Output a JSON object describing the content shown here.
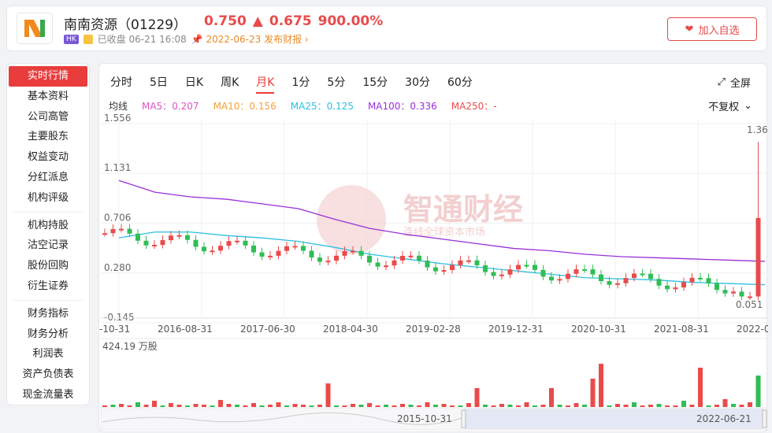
{
  "stock": {
    "name": "南南资源",
    "code": "（01229）",
    "price": "0.750",
    "change": "0.675",
    "change_pct": "900.00%",
    "market_badge": "HK",
    "status": "已收盘 06-21 16:08",
    "report_notice": "2022-06-23 发布财报",
    "up_color": "#e94b4b",
    "down_color": "#2fbe55"
  },
  "header": {
    "favorite_label": "加入自选"
  },
  "sidebar": {
    "groups": [
      [
        "实时行情",
        "基本资料",
        "公司高管",
        "主要股东",
        "权益变动",
        "分红派息",
        "机构评级"
      ],
      [
        "机构持股",
        "沽空记录",
        "股份回购",
        "衍生证券"
      ],
      [
        "财务指标",
        "财务分析",
        "利润表",
        "资产负债表",
        "现金流量表"
      ]
    ]
  },
  "tabs": [
    "分时",
    "5日",
    "日K",
    "周K",
    "月K",
    "1分",
    "5分",
    "15分",
    "30分",
    "60分"
  ],
  "active_tab": "月K",
  "fullscreen_label": "全屏",
  "adjust_label": "不复权",
  "ma_legend": [
    {
      "label": "均线",
      "color": "#333333"
    },
    {
      "label": "MA5：0.207",
      "color": "#e052c8"
    },
    {
      "label": "MA10：0.156",
      "color": "#f0a23b"
    },
    {
      "label": "MA25：0.125",
      "color": "#2bbfe0"
    },
    {
      "label": "MA100：0.336",
      "color": "#9a2fd8"
    },
    {
      "label": "MA250：-",
      "color": "#e94b4b"
    }
  ],
  "watermark": {
    "main": "智通财经",
    "sub": "连线全球资本市场"
  },
  "chart_data": {
    "type": "candlestick",
    "yticks": [
      "1.556",
      "1.131",
      "0.706",
      "0.280",
      "-0.145"
    ],
    "ylim": [
      -0.145,
      1.556
    ],
    "xticks": [
      "-10-31",
      "2016-08-31",
      "2017-06-30",
      "2018-04-30",
      "2019-02-28",
      "2019-12-31",
      "2020-10-31",
      "2021-08-31",
      "2022-0"
    ],
    "annotations": {
      "max": "1.36",
      "min": "0.051"
    },
    "volume_label": "424.19 万股",
    "range_start": "2015-10-31",
    "range_end": "2022-06-21",
    "series": [
      {
        "name": "MA100",
        "values": [
          1.07,
          0.97,
          0.93,
          0.91,
          0.87,
          0.83,
          0.74,
          0.66,
          0.61,
          0.57,
          0.53,
          0.49,
          0.47,
          0.44,
          0.42,
          0.41,
          0.4,
          0.39,
          0.38
        ]
      },
      {
        "name": "MA25",
        "values": [
          0.58,
          0.63,
          0.63,
          0.6,
          0.58,
          0.55,
          0.5,
          0.44,
          0.4,
          0.36,
          0.33,
          0.3,
          0.27,
          0.24,
          0.23,
          0.22,
          0.2,
          0.19,
          0.18
        ]
      }
    ]
  }
}
